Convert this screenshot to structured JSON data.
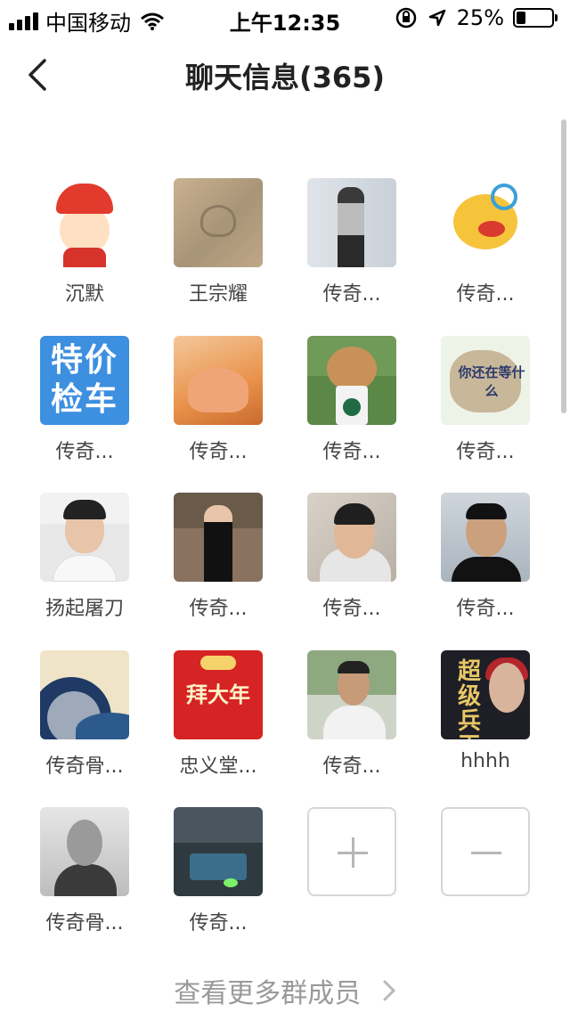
{
  "status_bar": {
    "carrier": "中国移动",
    "time": "上午12:35",
    "battery": "25%",
    "battery_level": 0.25,
    "icons": [
      "signal-icon",
      "wifi-icon",
      "rotation-lock-icon",
      "location-icon",
      "battery-icon"
    ]
  },
  "nav": {
    "back_icon": "chevron-left-icon",
    "title": "聊天信息(365)"
  },
  "members": [
    {
      "name": "沉默",
      "avatar": "cartoon-boy"
    },
    {
      "name": "王宗耀",
      "avatar": "sand-heart"
    },
    {
      "name": "传奇...",
      "avatar": "man-standing"
    },
    {
      "name": "传奇...",
      "avatar": "monkey-king"
    },
    {
      "name": "传奇...",
      "avatar": "text-tile",
      "avatar_text": [
        "特价",
        "检车"
      ]
    },
    {
      "name": "传奇...",
      "avatar": "hands-heart"
    },
    {
      "name": "传奇...",
      "avatar": "dog-coffee"
    },
    {
      "name": "传奇...",
      "avatar": "fist",
      "avatar_text": "你还在等什么"
    },
    {
      "name": "扬起屠刀",
      "avatar": "portrait"
    },
    {
      "name": "传奇...",
      "avatar": "man-in-room"
    },
    {
      "name": "传奇...",
      "avatar": "man-selfie"
    },
    {
      "name": "传奇...",
      "avatar": "man-car"
    },
    {
      "name": "传奇骨...",
      "avatar": "great-wave"
    },
    {
      "name": "忠义堂...",
      "avatar": "new-year-card",
      "avatar_text": "拜大年"
    },
    {
      "name": "传奇...",
      "avatar": "man-outdoor"
    },
    {
      "name": "hhhh",
      "avatar": "poster",
      "avatar_text": "超级兵王"
    },
    {
      "name": "传奇骨...",
      "avatar": "bw-portrait"
    },
    {
      "name": "传奇...",
      "avatar": "room"
    }
  ],
  "actions": {
    "add_icon": "plus-icon",
    "remove_icon": "minus-icon"
  },
  "footer": {
    "more_members": "查看更多群成员",
    "chevron_icon": "chevron-right-icon"
  }
}
